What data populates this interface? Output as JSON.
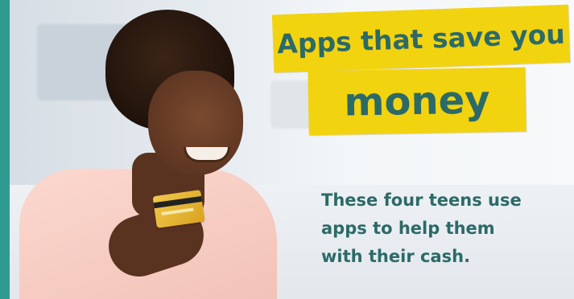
{
  "title": {
    "line1": "Apps that save you",
    "line2": "money"
  },
  "subtitle": {
    "line1": "These four teens use",
    "line2": "apps to help them",
    "line3": "with their cash."
  },
  "colors": {
    "banner_yellow": "#f2d30f",
    "text_teal": "#2c6a68",
    "border_teal": "#2f9a90"
  }
}
